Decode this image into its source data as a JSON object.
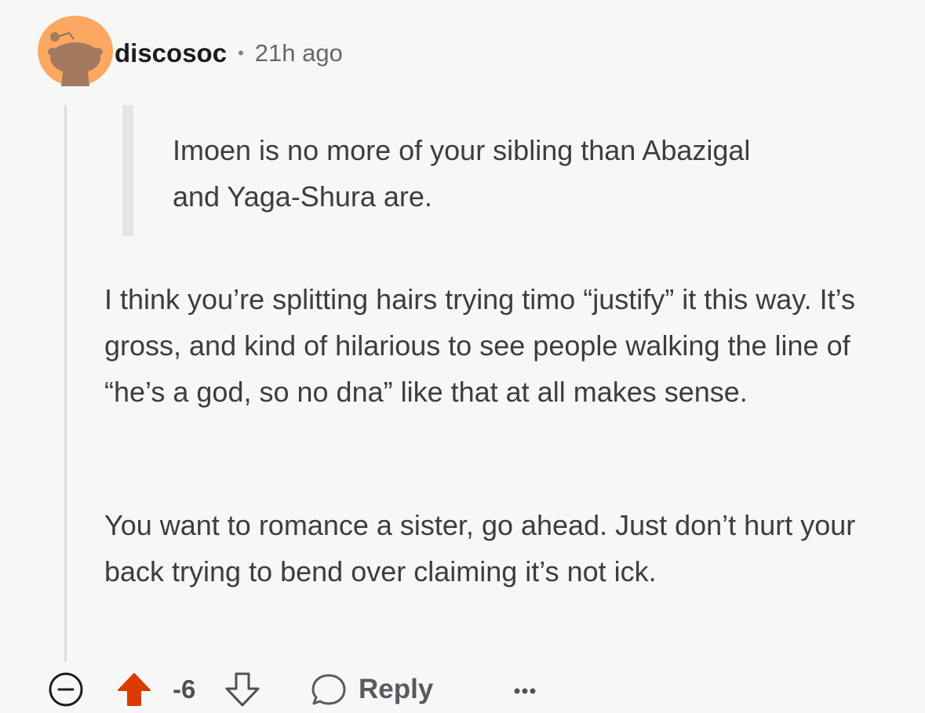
{
  "comment": {
    "username": "discosoc",
    "separator": "•",
    "timestamp": "21h ago",
    "quote": "Imoen is no more of your sibling than Abazigal and Yaga-Shura are.",
    "paragraphs": [
      "I think you’re splitting hairs trying timo “justify” it this way. It’s gross, and kind of hilarious to see people walking the line of “he’s a god, so no dna” like that at all makes sense.",
      "You want to romance a sister, go ahead. Just don’t hurt your back trying to bend over claiming it’s not ick."
    ]
  },
  "actions": {
    "score": "-6",
    "reply_label": "Reply",
    "upvote_state": "upvoted"
  },
  "icons": {
    "collapse": "minus-circle-icon",
    "upvote": "arrow-up-icon",
    "downvote": "arrow-down-icon",
    "reply": "speech-bubble-icon",
    "more": "ellipsis-icon",
    "avatar": "snoo-avatar"
  },
  "colors": {
    "avatar_bg": "#FDA861",
    "upvote_active": "#D93A00",
    "background": "#F7F7F7"
  }
}
